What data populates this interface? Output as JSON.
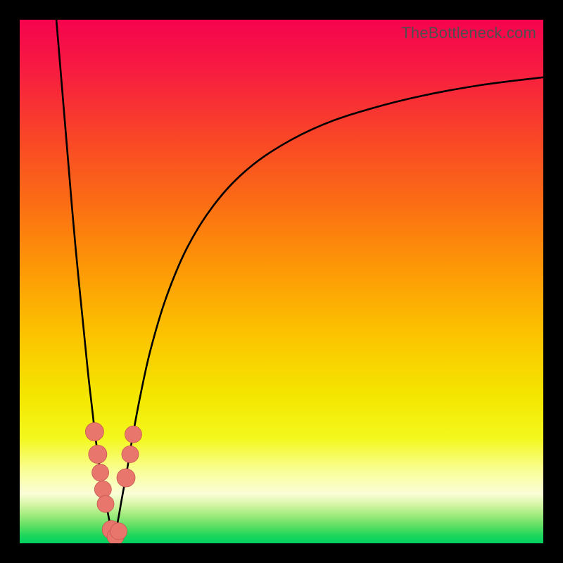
{
  "watermark": "TheBottleneck.com",
  "colors": {
    "black": "#000000",
    "curve": "#000000",
    "marker": "#e9766c",
    "marker_border": "#c65853"
  },
  "gradient_stops": [
    {
      "offset": 0.0,
      "color": "#f6034e"
    },
    {
      "offset": 0.1,
      "color": "#f71d40"
    },
    {
      "offset": 0.22,
      "color": "#f94428"
    },
    {
      "offset": 0.35,
      "color": "#fb6d14"
    },
    {
      "offset": 0.48,
      "color": "#fd9a06"
    },
    {
      "offset": 0.6,
      "color": "#fcc300"
    },
    {
      "offset": 0.72,
      "color": "#f4e700"
    },
    {
      "offset": 0.8,
      "color": "#f3f81e"
    },
    {
      "offset": 0.86,
      "color": "#f9fe95"
    },
    {
      "offset": 0.905,
      "color": "#fafdd7"
    },
    {
      "offset": 0.925,
      "color": "#d7f6a8"
    },
    {
      "offset": 0.945,
      "color": "#a3ec7e"
    },
    {
      "offset": 0.965,
      "color": "#64e065"
    },
    {
      "offset": 0.985,
      "color": "#1ed65b"
    },
    {
      "offset": 1.0,
      "color": "#00d161"
    }
  ],
  "chart_data": {
    "type": "line",
    "title": "",
    "xlabel": "",
    "ylabel": "",
    "xlim": [
      0,
      100
    ],
    "ylim": [
      0,
      100
    ],
    "series": [
      {
        "name": "left-branch",
        "x": [
          7.0,
          8.5,
          10.0,
          11.0,
          12.0,
          13.0,
          13.8,
          14.5,
          15.2,
          16.0,
          16.7,
          17.3,
          18.0
        ],
        "y": [
          100.0,
          82.0,
          64.0,
          53.0,
          43.0,
          33.0,
          26.0,
          20.0,
          15.0,
          10.0,
          6.5,
          3.5,
          1.0
        ]
      },
      {
        "name": "right-branch",
        "x": [
          18.0,
          18.7,
          19.5,
          20.5,
          21.5,
          23.0,
          25.0,
          28.0,
          32.0,
          37.0,
          43.0,
          50.0,
          58.0,
          67.0,
          77.0,
          88.0,
          100.0
        ],
        "y": [
          1.0,
          4.0,
          8.5,
          14.0,
          20.0,
          28.0,
          37.0,
          47.0,
          56.5,
          64.5,
          71.0,
          76.0,
          80.0,
          83.0,
          85.5,
          87.5,
          89.0
        ]
      }
    ],
    "markers": {
      "name": "highlighted-points",
      "x": [
        14.3,
        14.9,
        15.4,
        15.9,
        16.4,
        17.5,
        18.3,
        18.9,
        20.3,
        21.1,
        21.7
      ],
      "y": [
        21.3,
        17.0,
        13.5,
        10.3,
        7.5,
        2.6,
        1.3,
        2.3,
        12.5,
        17.0,
        20.8
      ],
      "r": [
        13,
        13,
        12,
        12,
        12,
        13,
        12,
        12,
        13,
        12,
        12
      ]
    }
  }
}
